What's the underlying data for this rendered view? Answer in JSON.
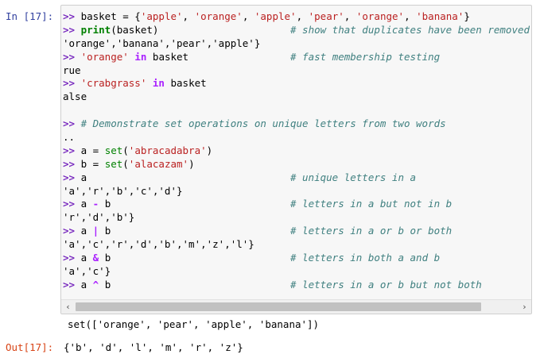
{
  "in_prompt": "In [17]:",
  "out_prompt": "Out[17]:",
  "code_lines": [
    [
      {
        "t": ">> ",
        "c": "gt"
      },
      {
        "t": "basket = {"
      },
      {
        "t": "'apple'",
        "c": "str"
      },
      {
        "t": ", "
      },
      {
        "t": "'orange'",
        "c": "str"
      },
      {
        "t": ", "
      },
      {
        "t": "'apple'",
        "c": "str"
      },
      {
        "t": ", "
      },
      {
        "t": "'pear'",
        "c": "str"
      },
      {
        "t": ", "
      },
      {
        "t": "'orange'",
        "c": "str"
      },
      {
        "t": ", "
      },
      {
        "t": "'banana'",
        "c": "str"
      },
      {
        "t": "}"
      }
    ],
    [
      {
        "t": ">> ",
        "c": "gt"
      },
      {
        "t": "print",
        "c": "kw"
      },
      {
        "t": "(basket)                      "
      },
      {
        "t": "# show that duplicates have been removed",
        "c": "cm"
      }
    ],
    [
      {
        "t": "'orange','banana','pear','apple'}"
      }
    ],
    [
      {
        "t": ">> ",
        "c": "gt"
      },
      {
        "t": "'orange'",
        "c": "str"
      },
      {
        "t": " "
      },
      {
        "t": "in",
        "c": "op"
      },
      {
        "t": " basket                 "
      },
      {
        "t": "# fast membership testing",
        "c": "cm"
      }
    ],
    [
      {
        "t": "rue"
      }
    ],
    [
      {
        "t": ">> ",
        "c": "gt"
      },
      {
        "t": "'crabgrass'",
        "c": "str"
      },
      {
        "t": " "
      },
      {
        "t": "in",
        "c": "op"
      },
      {
        "t": " basket"
      }
    ],
    [
      {
        "t": "alse"
      }
    ],
    [
      {
        "t": ""
      }
    ],
    [
      {
        "t": ">> ",
        "c": "gt"
      },
      {
        "t": "# Demonstrate set operations on unique letters from two words",
        "c": "cm"
      }
    ],
    [
      {
        "t": ".."
      }
    ],
    [
      {
        "t": ">> ",
        "c": "gt"
      },
      {
        "t": "a = "
      },
      {
        "t": "set",
        "c": "bi"
      },
      {
        "t": "("
      },
      {
        "t": "'abracadabra'",
        "c": "str"
      },
      {
        "t": ")"
      }
    ],
    [
      {
        "t": ">> ",
        "c": "gt"
      },
      {
        "t": "b = "
      },
      {
        "t": "set",
        "c": "bi"
      },
      {
        "t": "("
      },
      {
        "t": "'alacazam'",
        "c": "str"
      },
      {
        "t": ")"
      }
    ],
    [
      {
        "t": ">> ",
        "c": "gt"
      },
      {
        "t": "a                                  "
      },
      {
        "t": "# unique letters in a",
        "c": "cm"
      }
    ],
    [
      {
        "t": "'a','r','b','c','d'}"
      }
    ],
    [
      {
        "t": ">> ",
        "c": "gt"
      },
      {
        "t": "a "
      },
      {
        "t": "-",
        "c": "op"
      },
      {
        "t": " b                              "
      },
      {
        "t": "# letters in a but not in b",
        "c": "cm"
      }
    ],
    [
      {
        "t": "'r','d','b'}"
      }
    ],
    [
      {
        "t": ">> ",
        "c": "gt"
      },
      {
        "t": "a "
      },
      {
        "t": "|",
        "c": "op"
      },
      {
        "t": " b                              "
      },
      {
        "t": "# letters in a or b or both",
        "c": "cm"
      }
    ],
    [
      {
        "t": "'a','c','r','d','b','m','z','l'}"
      }
    ],
    [
      {
        "t": ">> ",
        "c": "gt"
      },
      {
        "t": "a "
      },
      {
        "t": "&",
        "c": "op"
      },
      {
        "t": " b                              "
      },
      {
        "t": "# letters in both a and b",
        "c": "cm"
      }
    ],
    [
      {
        "t": "'a','c'}"
      }
    ],
    [
      {
        "t": ">> ",
        "c": "gt"
      },
      {
        "t": "a "
      },
      {
        "t": "^",
        "c": "op"
      },
      {
        "t": " b                              "
      },
      {
        "t": "# letters in a or b but not both",
        "c": "cm"
      }
    ]
  ],
  "scroll_left_icon": "‹",
  "scroll_right_icon": "›",
  "stdout_text": "set(['orange', 'pear', 'apple', 'banana'])",
  "result_text": "{'b', 'd', 'l', 'm', 'r', 'z'}"
}
